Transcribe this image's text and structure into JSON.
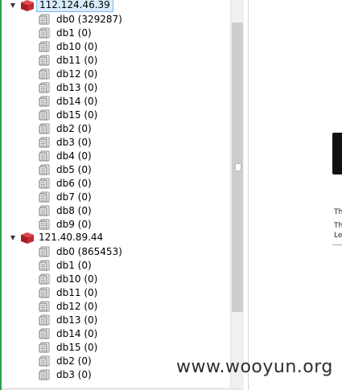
{
  "servers": [
    {
      "label": "112.124.46.39",
      "selected": true,
      "databases": [
        "db0 (329287)",
        "db1 (0)",
        "db10 (0)",
        "db11 (0)",
        "db12 (0)",
        "db13 (0)",
        "db14 (0)",
        "db15 (0)",
        "db2 (0)",
        "db3 (0)",
        "db4 (0)",
        "db5 (0)",
        "db6 (0)",
        "db7 (0)",
        "db8 (0)",
        "db9 (0)"
      ]
    },
    {
      "label": "121.40.89.44",
      "selected": false,
      "databases": [
        "db0 (865453)",
        "db1 (0)",
        "db10 (0)",
        "db11 (0)",
        "db12 (0)",
        "db13 (0)",
        "db14 (0)",
        "db15 (0)",
        "db2 (0)",
        "db3 (0)"
      ]
    }
  ],
  "right_pane": {
    "line1": "Th",
    "line2": "Th",
    "line3": "Le"
  },
  "watermark": "www.wooyun.org",
  "colors": {
    "accent_left_border": "#2aa34a",
    "selection_bg": "#d9ecfb",
    "server_icon": "#c0262d"
  }
}
